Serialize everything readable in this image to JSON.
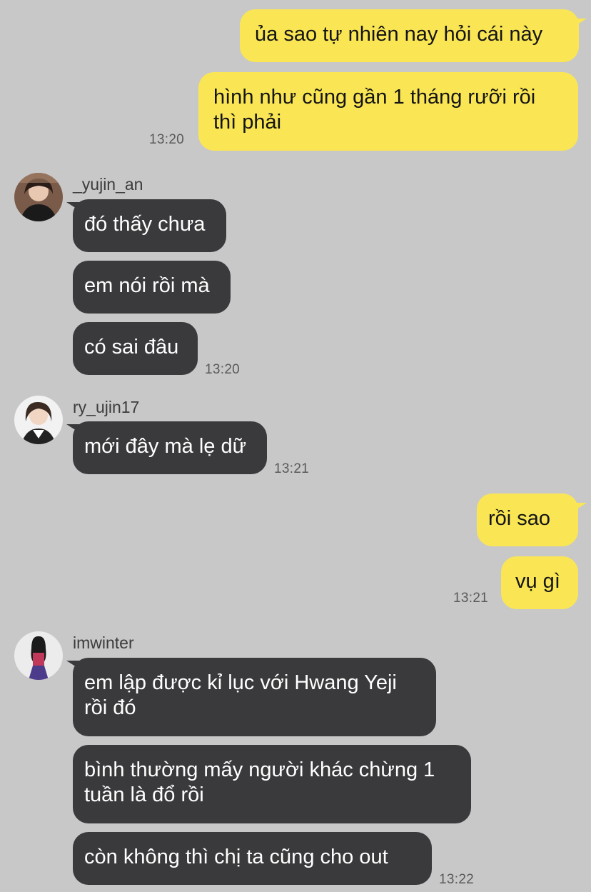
{
  "colors": {
    "background": "#c8c8c8",
    "outgoing_bubble": "#fae654",
    "incoming_bubble": "#3a3a3c",
    "outgoing_text": "#141414",
    "incoming_text": "#ffffff",
    "timestamp": "#5a5a5a"
  },
  "messages": {
    "out1": {
      "text": "ủa sao tự nhiên nay hỏi cái này"
    },
    "out2": {
      "text": "hình như cũng gần 1 tháng rưỡi rồi thì phải",
      "time": "13:20"
    },
    "g1": {
      "sender": "_yujin_an",
      "avatar_icon": "user-avatar-photo",
      "m1": "đó thấy chưa",
      "m2": "em nói rồi mà",
      "m3": "có sai đâu",
      "time": "13:20"
    },
    "g2": {
      "sender": "ry_ujin17",
      "avatar_icon": "user-avatar-photo",
      "m1": "mới đây mà lẹ dữ",
      "time": "13:21"
    },
    "out3": {
      "text": "rồi sao"
    },
    "out4": {
      "text": "vụ gì",
      "time": "13:21"
    },
    "g3": {
      "sender": "imwinter",
      "avatar_icon": "user-avatar-photo",
      "m1": "em lập được kỉ lục với Hwang Yeji rồi đó",
      "m2": "bình thường mấy người khác chừng 1 tuần là đổ rồi",
      "m3": "còn không thì chị ta cũng cho out",
      "time": "13:22"
    }
  }
}
